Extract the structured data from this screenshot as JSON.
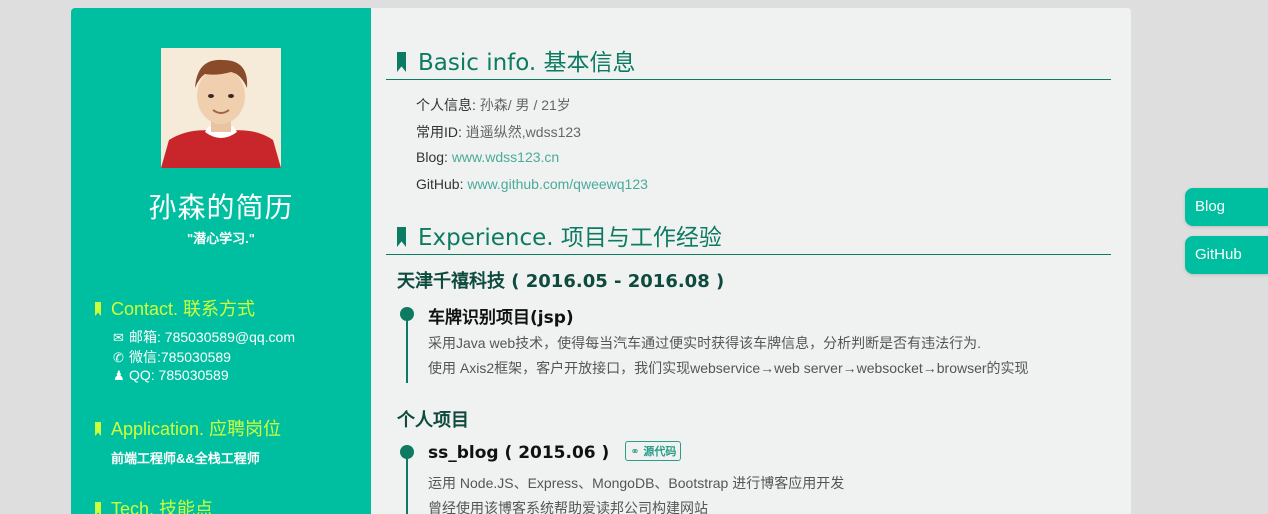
{
  "sidebar": {
    "name": "孙森的简历",
    "motto": "\"潜心学习.\"",
    "contact": {
      "heading": "Contact. 联系方式",
      "email": "邮箱: 785030589@qq.com",
      "wechat": "微信:785030589",
      "qq": "QQ: 785030589"
    },
    "application": {
      "heading": "Application. 应聘岗位",
      "position": "前端工程师&&全栈工程师"
    },
    "tech": {
      "heading": "Tech. 技能点"
    }
  },
  "main": {
    "basic": {
      "heading": "Basic info. 基本信息",
      "personal_label": "个人信息:",
      "personal_value": "孙森/ 男 / 21岁",
      "id_label": "常用ID:",
      "id_value": "逍遥纵然,wdss123",
      "blog_label": "Blog:",
      "blog_value": "www.wdss123.cn",
      "github_label": "GitHub:",
      "github_value": "www.github.com/qweewq123"
    },
    "experience": {
      "heading": "Experience. 项目与工作经验",
      "company": "天津千禧科技 ( 2016.05 - 2016.08 )",
      "project1_title": "车牌识别项目(jsp)",
      "project1_desc1": "采用Java web技术，使得每当汽车通过便实时获得该车牌信息，分析判断是否有违法行为.",
      "project1_desc2": "使用 Axis2框架，客户开放接口，我们实现webservice→web server→websocket→browser的实现",
      "personal_heading": "个人项目",
      "project2_title": "ss_blog ( 2015.06 )",
      "project2_badge": "源代码",
      "project2_desc1": "运用 Node.JS、Express、MongoDB、Bootstrap 进行博客应用开发",
      "project2_desc2": "曾经使用该博客系统帮助爱读邦公司构建网站"
    }
  },
  "float_buttons": {
    "blog": "Blog",
    "github": "GitHub"
  }
}
